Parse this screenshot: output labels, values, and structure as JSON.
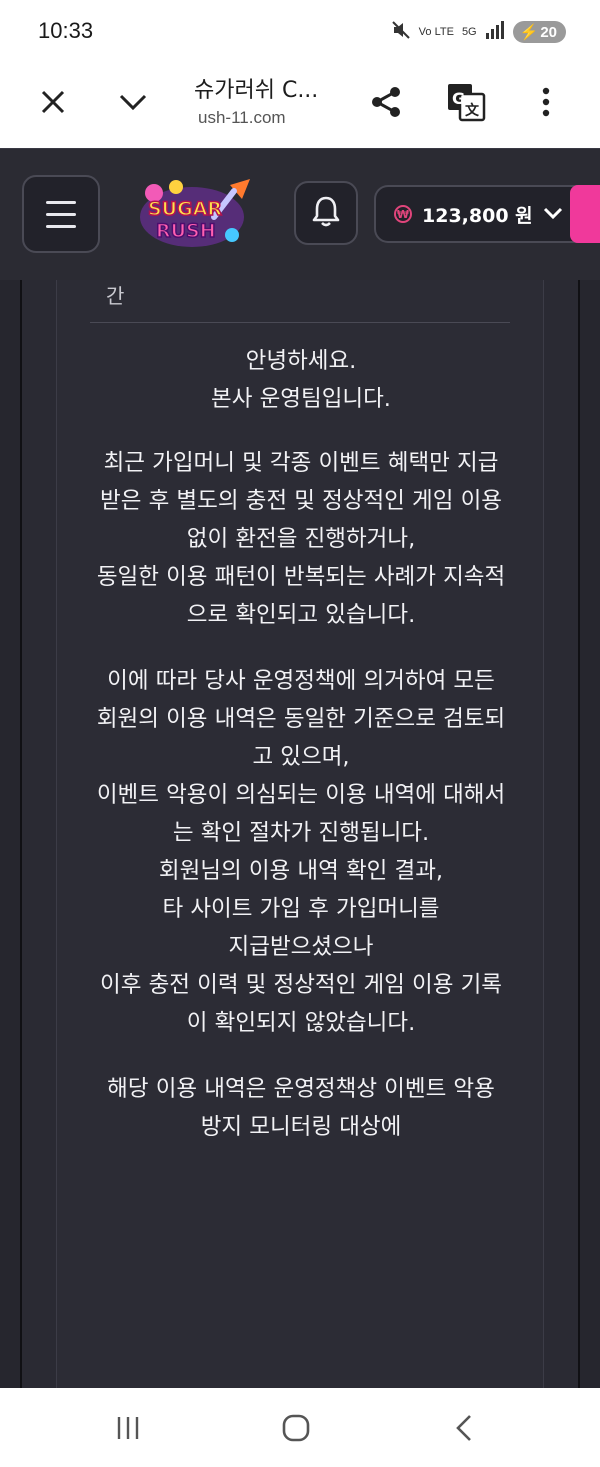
{
  "status_bar": {
    "time": "10:33",
    "network_label": "Vo LTE",
    "signal_label": "5G",
    "battery": "20"
  },
  "browser": {
    "title": "슈가러쉬 C...",
    "url": "ush-11.com",
    "icons": [
      "close-icon",
      "chevron-down-icon",
      "share-icon",
      "translate-icon",
      "more-vert-icon"
    ]
  },
  "site_header": {
    "logo_text_top": "SUGAR",
    "logo_text_bottom": "RUSH",
    "balance": "123,800 원",
    "accent_color": "#f0399b"
  },
  "content": {
    "prev_label": "간",
    "paragraphs": [
      [
        "안녕하세요.",
        "본사 운영팀입니다."
      ],
      [
        "최근 가입머니 및 각종 이벤트 혜택만 지급받은 후 별도의 충전 및 정상적인 게임 이용 없이 환전을 진행하거나,",
        "동일한 이용 패턴이 반복되는 사례가 지속적으로 확인되고 있습니다."
      ],
      [
        "이에 따라 당사 운영정책에 의거하여 모든 회원의 이용 내역은 동일한 기준으로 검토되고 있으며,",
        "이벤트 악용이 의심되는 이용 내역에 대해서는 확인 절차가 진행됩니다.",
        "회원님의 이용 내역 확인 결과,",
        "타 사이트 가입 후 가입머니를",
        "지급받으셨으나",
        "이후 충전 이력 및 정상적인 게임 이용 기록이 확인되지 않았습니다."
      ],
      [
        "해당 이용 내역은 운영정책상 이벤트 악용 방지 모니터링 대상에"
      ]
    ]
  },
  "nav_bar": {
    "items": [
      "recents-icon",
      "home-icon",
      "back-icon"
    ]
  }
}
